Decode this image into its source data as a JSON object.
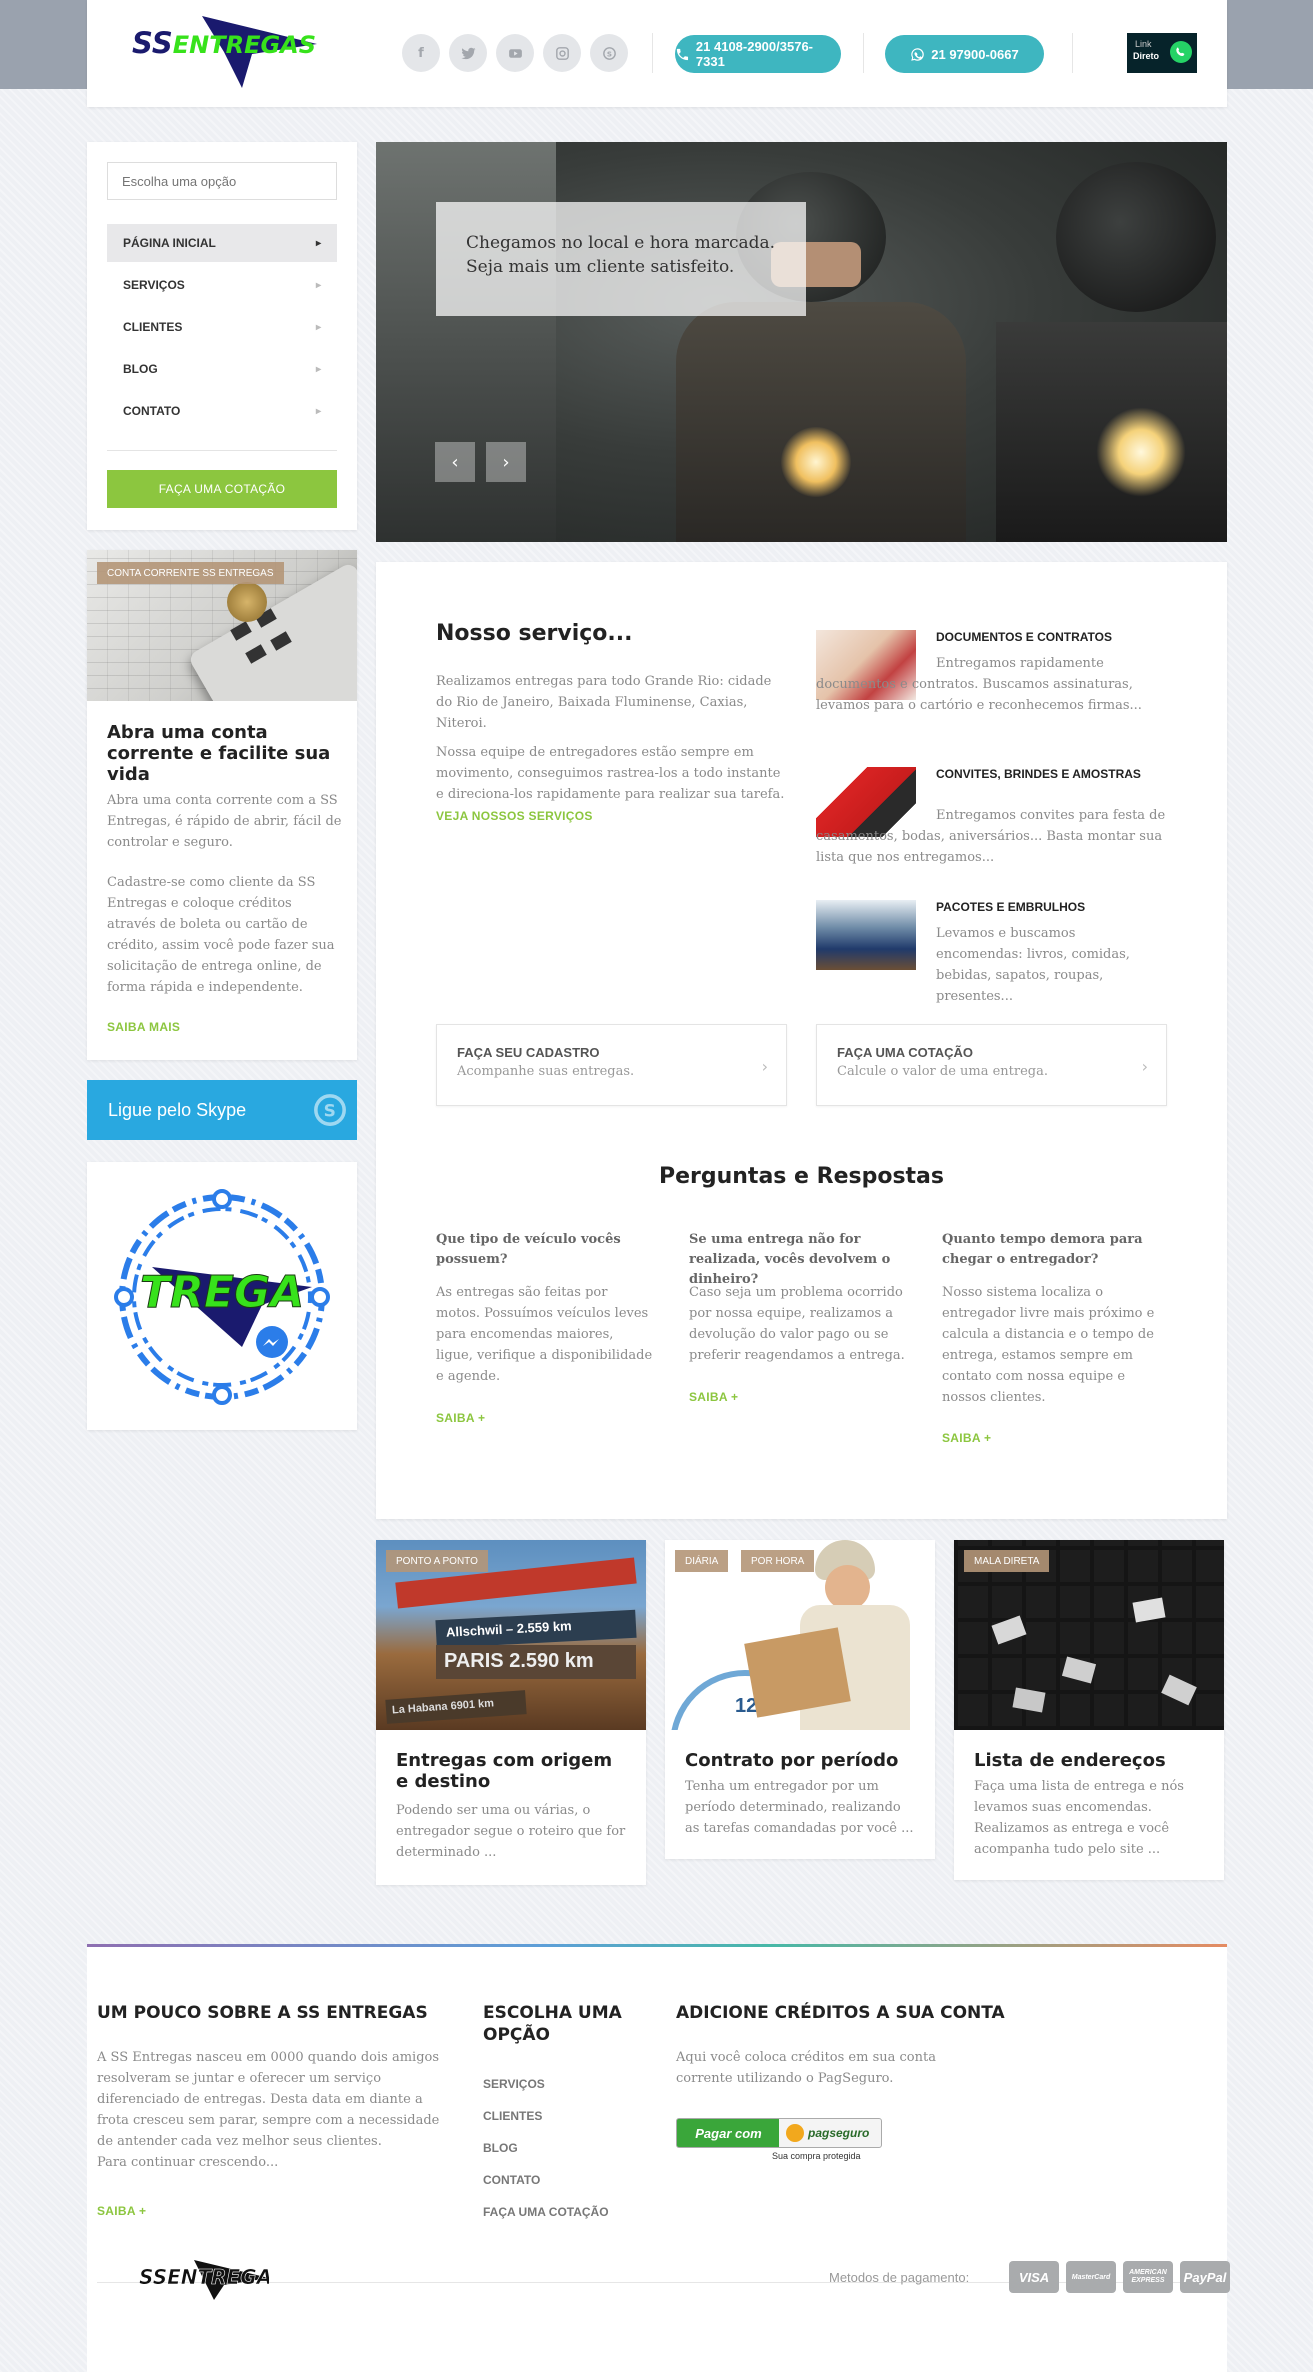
{
  "header": {
    "logo_text": "SSENTREGAS",
    "social_icons": [
      "facebook-icon",
      "twitter-icon",
      "youtube-icon",
      "instagram-icon",
      "skype-icon"
    ],
    "phone_label": "21 4108-2900/3576-7331",
    "whatsapp_label": "21 97900-0667",
    "whatsapp_badge": {
      "line1": "Link",
      "line2": "Direto"
    }
  },
  "sidebar": {
    "search_placeholder": "Escolha uma opção",
    "nav_items": [
      {
        "label": "PÁGINA INICIAL",
        "active": true
      },
      {
        "label": "SERVIÇOS",
        "active": false
      },
      {
        "label": "CLIENTES",
        "active": false
      },
      {
        "label": "BLOG",
        "active": false
      },
      {
        "label": "CONTATO",
        "active": false
      }
    ],
    "quote_button": "FAÇA UMA COTAÇÃO"
  },
  "promo": {
    "tag": "CONTA CORRENTE SS ENTREGAS",
    "title": "Abra uma conta corrente e facilite sua vida",
    "text1": "Abra uma conta corrente com a SS Entregas, é rápido de abrir, fácil de controlar e seguro.",
    "text2": "Cadastre-se como cliente da SS Entregas e coloque créditos através de boleta ou cartão de crédito, assim você pode fazer sua solicitação de entrega online, de forma rápida e independente.",
    "link": "SAIBA MAIS"
  },
  "skype": {
    "label": "Ligue pelo Skype"
  },
  "messenger_code": {
    "text": "TREGA"
  },
  "hero": {
    "caption_line1": "Chegamos no local e hora marcada.",
    "caption_line2": "Seja mais um cliente satisfeito.",
    "prev_icon": "chevron-left-icon",
    "next_icon": "chevron-right-icon"
  },
  "services": {
    "title": "Nosso serviço...",
    "para1": "Realizamos entregas para todo Grande Rio: cidade do Rio de Janeiro, Baixada Fluminense, Caxias, Niteroi.",
    "para2": "Nossa equipe de entregadores estão sempre em movimento, conseguimos rastrea-los a todo instante e direciona-los rapidamente para realizar sua tarefa.",
    "link": "VEJA NOSSOS SERVIÇOS",
    "items": [
      {
        "title": "DOCUMENTOS E CONTRATOS",
        "text": "Entregamos rapidamente documentos e contratos. Buscamos assinaturas, levamos para o cartório e reconhecemos firmas..."
      },
      {
        "title": "CONVITES, BRINDES E AMOSTRAS",
        "text": "Entregamos convites para festa de casamentos, bodas, aniversários... Basta montar sua lista que nos entregamos..."
      },
      {
        "title": "PACOTES E EMBRULHOS",
        "text": "Levamos e buscamos encomendas: livros, comidas, bebidas, sapatos, roupas, presentes..."
      }
    ]
  },
  "cta": [
    {
      "title": "FAÇA SEU CADASTRO",
      "subtitle": "Acompanhe suas entregas."
    },
    {
      "title": "FAÇA UMA COTAÇÃO",
      "subtitle": "Calcule o valor de uma entrega."
    }
  ],
  "faq": {
    "title": "Perguntas e Respostas",
    "items": [
      {
        "q": "Que tipo de veículo vocês possuem?",
        "a": "As entregas são feitas por motos. Possuímos veículos leves para encomendas maiores, ligue, verifique a disponibilidade e agende.",
        "link": "SAIBA +"
      },
      {
        "q": "Se uma entrega não for realizada, vocês devolvem o dinheiro?",
        "a": "Caso seja um problema ocorrido por nossa equipe, realizamos a devolução do valor pago ou se preferir reagendamos a entrega.",
        "link": "SAIBA +"
      },
      {
        "q": "Quanto tempo demora para chegar o entregador?",
        "a": "Nosso sistema localiza o entregador livre mais próximo e calcula a distancia e o tempo de entrega, estamos sempre em contato com nossa equipe e nossos clientes.",
        "link": "SAIBA +"
      }
    ]
  },
  "blog_cards": [
    {
      "tags": [
        "PONTO A PONTO"
      ],
      "title": "Entregas com origem e destino",
      "text": "Podendo ser uma ou várias, o entregador segue o roteiro que for determinado ...",
      "image_sign1": "Allschwil – 2.559 km",
      "image_sign2": "PARIS 2.590 km",
      "image_sign3": "La Habana 6901 km"
    },
    {
      "tags": [
        "DIÁRIA",
        "POR HORA"
      ],
      "title": "Contrato por período",
      "text": "Tenha um entregador por um período determinado, realizando as tarefas comandadas por você ...",
      "image_clock": "12"
    },
    {
      "tags": [
        "MALA DIRETA"
      ],
      "title": "Lista de endereços",
      "text": "Faça uma lista de entrega e nós levamos suas encomendas. Realizamos as entrega e você acompanha tudo pelo site ..."
    }
  ],
  "footer": {
    "about_title": "UM POUCO SOBRE A SS ENTREGAS",
    "about_text": "A SS Entregas nasceu em 0000 quando dois amigos resolveram se juntar e oferecer um serviço diferenciado de entregas. Desta data em diante a frota cresceu sem parar, sempre com a necessidade de antender cada vez melhor seus clientes.",
    "about_text2": "Para continuar crescendo...",
    "about_link": "SAIBA +",
    "menu_title": "ESCOLHA UMA OPÇÃO",
    "menu_links": [
      "SERVIÇOS",
      "CLIENTES",
      "BLOG",
      "CONTATO",
      "FAÇA UMA COTAÇÃO"
    ],
    "credits_title": "ADICIONE CRÉDITOS A SUA CONTA",
    "credits_text": "Aqui você coloca créditos em sua conta corrente utilizando o PagSeguro.",
    "pagseguro_button": "Pagar com",
    "pagseguro_brand": "pagseguro",
    "pagseguro_note": "Sua compra protegida",
    "payment_label": "Metodos de pagamento:",
    "payment_methods": [
      "VISA",
      "MasterCard",
      "AMERICAN EXPRESS",
      "PayPal"
    ],
    "logo_text": "SSENTREGAS"
  },
  "colors": {
    "accent_green": "#8cc63f",
    "teal": "#3eb6c0",
    "skype_blue": "#29a8e0",
    "logo_green": "#37e21b",
    "logo_navy": "#1a1a6e"
  }
}
